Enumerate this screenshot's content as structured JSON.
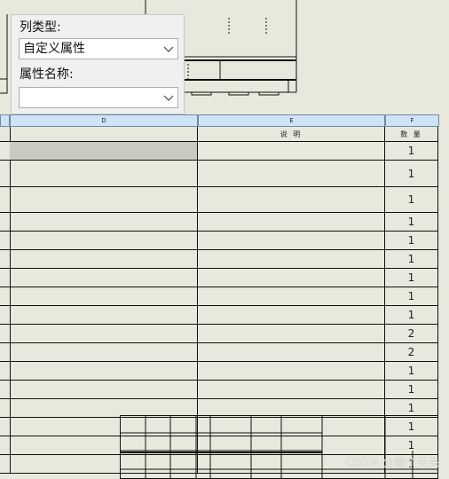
{
  "panel": {
    "column_type_label": "列类型:",
    "column_type_value": "自定义属性",
    "property_name_label": "属性名称:",
    "property_name_value": ""
  },
  "table": {
    "columns": [
      {
        "letter": "D"
      },
      {
        "letter": "E"
      },
      {
        "letter": "F"
      }
    ],
    "header_row": {
      "description": "说 明",
      "quantity": "数 量"
    },
    "quantities": [
      "1",
      "1",
      "1",
      "1",
      "1",
      "1",
      "1",
      "1",
      "1",
      "2",
      "2",
      "1",
      "1",
      "1",
      "1",
      "1",
      "1"
    ]
  },
  "watermark": "CSDN @烟个头头"
}
